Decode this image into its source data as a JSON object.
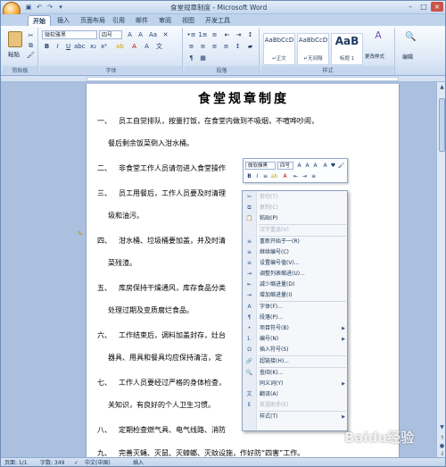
{
  "window": {
    "title": "食堂规章制度 - Microsoft Word"
  },
  "tabs": [
    "开始",
    "插入",
    "页面布局",
    "引用",
    "邮件",
    "审阅",
    "视图",
    "开发工具"
  ],
  "ribbon": {
    "clipboard": {
      "label": "剪贴板",
      "paste": "粘贴"
    },
    "font": {
      "label": "字体",
      "family": "微软雅黑",
      "size": "四号"
    },
    "paragraph": {
      "label": "段落"
    },
    "styles": {
      "label": "样式",
      "items": [
        {
          "preview": "AaBbCcD",
          "name": "↵正文"
        },
        {
          "preview": "AaBbCcD",
          "name": "↵无间隔"
        },
        {
          "preview": "AaB",
          "name": "标题 1"
        }
      ],
      "change": "更改样式"
    },
    "editing": {
      "label": "编辑"
    }
  },
  "document": {
    "title": "食堂规章制度",
    "paragraphs": [
      {
        "num": "一、",
        "text": "员工自觉排队，按量打饭，在食堂内做到不吸烟，不喧哗吵闹，",
        "cont": "餐后剩余饭菜倒入泔水桶。"
      },
      {
        "num": "二、",
        "text": "非食堂工作人员请勿进入食堂操作"
      },
      {
        "num": "三、",
        "text": "员工用餐后，工作人员要及时清理",
        "cont": "圾和油污。"
      },
      {
        "num": "四、",
        "text": "泔水桶、垃圾桶要加盖，并及时清",
        "cont": "菜残渣。"
      },
      {
        "num": "五、",
        "text": "库房保持干燥通风，库存食品分类",
        "cont": "处理过期及变质腐烂食品。"
      },
      {
        "num": "六、",
        "text": "工作结束后，调料加盖封存，灶台",
        "cont": "器具、用具和餐具均应保持清洁，定"
      },
      {
        "num": "七、",
        "text": "工作人员要经过严格的身体检查，",
        "cont": "关知识，有良好的个人卫生习惯。"
      },
      {
        "num": "八、",
        "text": "定期检查燃气具、电气线路、消防"
      },
      {
        "num": "九、",
        "text": "完善灭蝇、灭鼠、灭蟑螂、灭蚊设施，作好防“四害”工作。"
      }
    ]
  },
  "minibar": {
    "font": "微软雅黑",
    "size": "四号"
  },
  "context_menu": {
    "items": [
      {
        "label": "剪切(T)",
        "enabled": false,
        "icon": "cut-icon",
        "glyph": "✂"
      },
      {
        "label": "复制(C)",
        "enabled": false,
        "icon": "copy-icon",
        "glyph": "⧉"
      },
      {
        "label": "粘贴(P)",
        "enabled": true,
        "icon": "paste-icon",
        "glyph": "📋"
      },
      {
        "label": "汉字重选(V)",
        "enabled": false,
        "icon": "",
        "glyph": ""
      },
      {
        "label": "重新开始于一(R)",
        "enabled": true,
        "icon": "restart-numbering-icon",
        "glyph": "≡"
      },
      {
        "label": "继续编号(C)",
        "enabled": true,
        "icon": "continue-numbering-icon",
        "glyph": "≡"
      },
      {
        "label": "设置编号值(V)...",
        "enabled": true,
        "icon": "set-numbering-value-icon",
        "glyph": "≡"
      },
      {
        "label": "调整列表缩进(U)...",
        "enabled": true,
        "icon": "list-indent-icon",
        "glyph": "⇥"
      },
      {
        "label": "减少缩进量(D)",
        "enabled": true,
        "icon": "decrease-indent-icon",
        "glyph": "⇤"
      },
      {
        "label": "增加缩进量(I)",
        "enabled": true,
        "icon": "increase-indent-icon",
        "glyph": "⇥"
      },
      {
        "label": "字体(F)...",
        "enabled": true,
        "icon": "font-icon",
        "glyph": "A"
      },
      {
        "label": "段落(P)...",
        "enabled": true,
        "icon": "paragraph-icon",
        "glyph": "¶"
      },
      {
        "label": "项目符号(B)",
        "enabled": true,
        "icon": "bullets-icon",
        "glyph": "•",
        "submenu": true
      },
      {
        "label": "编号(N)",
        "enabled": true,
        "icon": "numbering-icon",
        "glyph": "1.",
        "submenu": true
      },
      {
        "label": "插入符号(S)",
        "enabled": true,
        "icon": "insert-symbol-icon",
        "glyph": "Ω"
      },
      {
        "label": "超链接(H)...",
        "enabled": true,
        "icon": "hyperlink-icon",
        "glyph": "🔗"
      },
      {
        "label": "查阅(K)...",
        "enabled": true,
        "icon": "lookup-icon",
        "glyph": "🔍"
      },
      {
        "label": "同义词(Y)",
        "enabled": true,
        "icon": "synonyms-icon",
        "glyph": "",
        "submenu": true
      },
      {
        "label": "翻译(A)",
        "enabled": true,
        "icon": "translate-icon",
        "glyph": "文"
      },
      {
        "label": "英语助手(E)",
        "enabled": false,
        "icon": "english-assistant-icon",
        "glyph": "E"
      },
      {
        "label": "样式(T)",
        "enabled": true,
        "icon": "",
        "glyph": "",
        "submenu": true
      }
    ]
  },
  "status": {
    "page": "页面: 1/1",
    "words": "字数: 349",
    "lang": "中文(中国)",
    "insert": "插入"
  },
  "watermark": "Baidu经验"
}
